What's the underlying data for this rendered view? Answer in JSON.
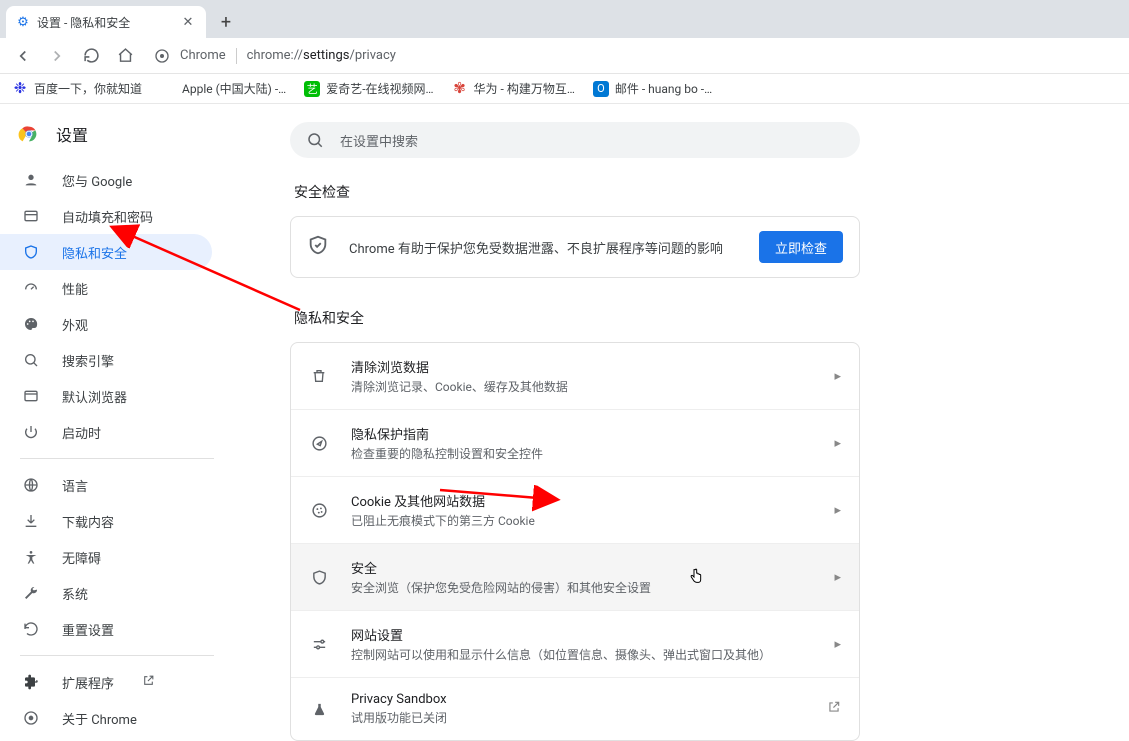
{
  "window": {
    "tab_title": "设置 - 隐私和安全",
    "url_prefix": "Chrome",
    "url_path_before": "chrome://",
    "url_path_bold": "settings",
    "url_path_after": "/privacy"
  },
  "bookmarks": [
    {
      "label": "百度一下，你就知道"
    },
    {
      "label": "Apple (中国大陆) -…"
    },
    {
      "label": "爱奇艺-在线视频网…"
    },
    {
      "label": "华为 - 构建万物互…"
    },
    {
      "label": "邮件 - huang bo -…"
    }
  ],
  "sidebar": {
    "title": "设置",
    "items": [
      {
        "label": "您与 Google"
      },
      {
        "label": "自动填充和密码"
      },
      {
        "label": "隐私和安全"
      },
      {
        "label": "性能"
      },
      {
        "label": "外观"
      },
      {
        "label": "搜索引擎"
      },
      {
        "label": "默认浏览器"
      },
      {
        "label": "启动时"
      }
    ],
    "extra": [
      {
        "label": "语言"
      },
      {
        "label": "下载内容"
      },
      {
        "label": "无障碍"
      },
      {
        "label": "系统"
      },
      {
        "label": "重置设置"
      }
    ],
    "footer": [
      {
        "label": "扩展程序"
      },
      {
        "label": "关于 Chrome"
      }
    ]
  },
  "search": {
    "placeholder": "在设置中搜索"
  },
  "sections": {
    "safety_title": "安全检查",
    "safety_desc": "Chrome 有助于保护您免受数据泄露、不良扩展程序等问题的影响",
    "safety_button": "立即检查",
    "privacy_title": "隐私和安全",
    "rows": [
      {
        "title": "清除浏览数据",
        "sub": "清除浏览记录、Cookie、缓存及其他数据"
      },
      {
        "title": "隐私保护指南",
        "sub": "检查重要的隐私控制设置和安全控件"
      },
      {
        "title": "Cookie 及其他网站数据",
        "sub": "已阻止无痕模式下的第三方 Cookie"
      },
      {
        "title": "安全",
        "sub": "安全浏览（保护您免受危险网站的侵害）和其他安全设置"
      },
      {
        "title": "网站设置",
        "sub": "控制网站可以使用和显示什么信息（如位置信息、摄像头、弹出式窗口及其他）"
      },
      {
        "title": "Privacy Sandbox",
        "sub": "试用版功能已关闭"
      }
    ]
  }
}
